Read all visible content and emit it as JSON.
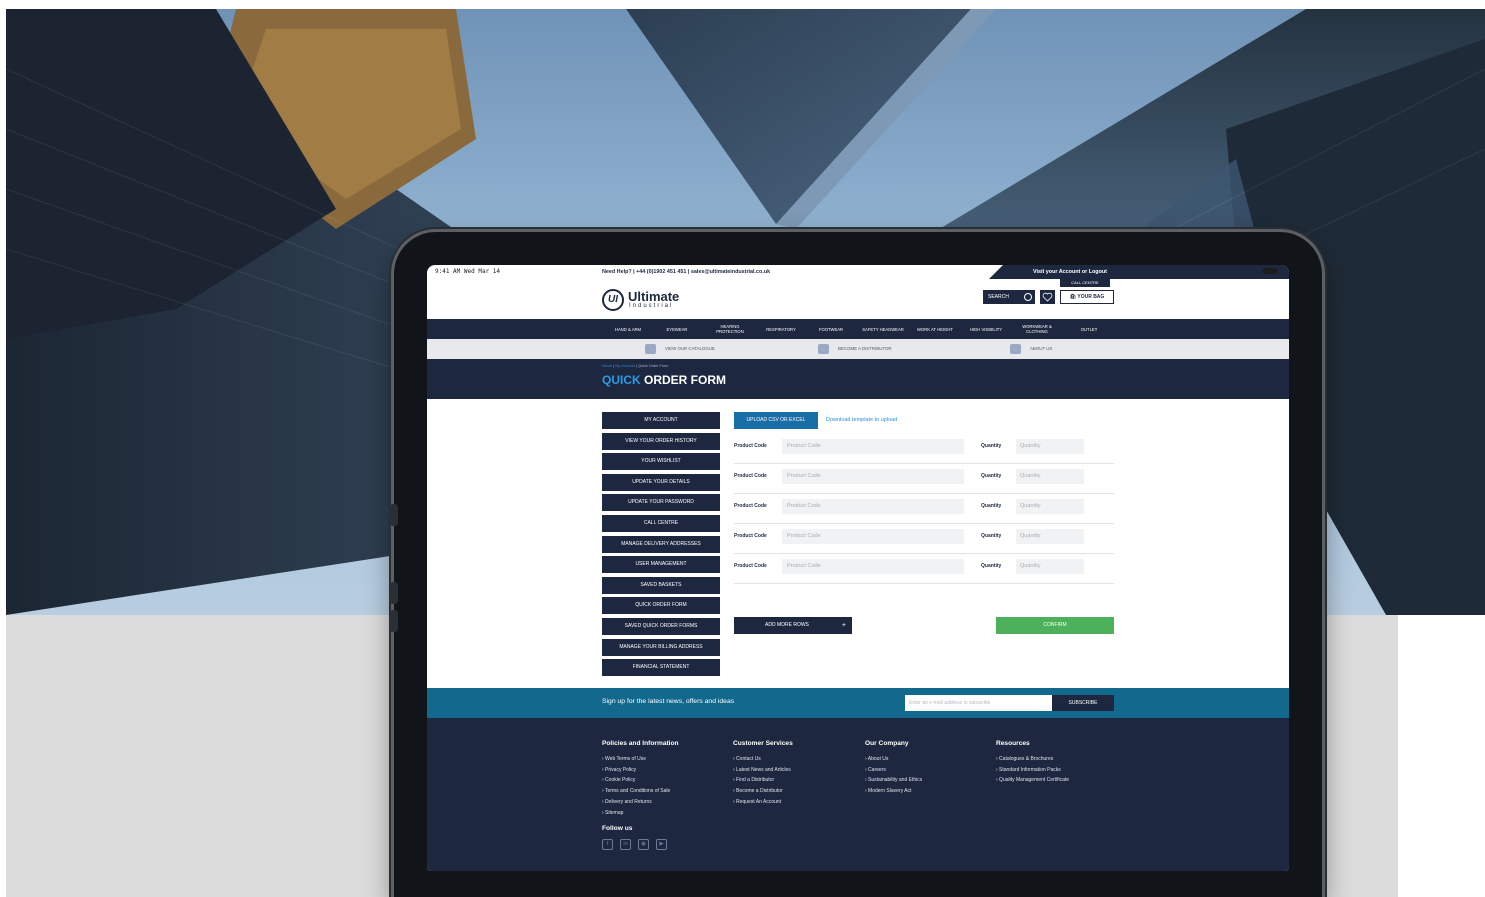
{
  "status_bar": {
    "time": "9:41 AM  Wed Mar 14"
  },
  "topbar": {
    "help": "Need Help?  |  +44 (0)1902 451 451  |  sales@ultimateindustrial.co.uk",
    "account": "Visit your Account or Logout",
    "call_centre": "CALL CENTRE"
  },
  "header": {
    "logo_mark": "UI",
    "logo_name": "Ultimate",
    "logo_sub": "Industrial",
    "search_label": "SEARCH",
    "bag_label": "YOUR BAG"
  },
  "nav": [
    "HAND & ARM",
    "EYEWEAR",
    "HEARING PROTECTION",
    "RESPIRATORY",
    "FOOTWEAR",
    "SAFETY HEADWEAR",
    "WORK AT HEIGHT",
    "HIGH VISIBILITY",
    "WORKWEAR & CLOTHING",
    "OUTLET"
  ],
  "utility": [
    "VIEW OUR CATALOGUE",
    "BECOME A DISTRIBUTOR",
    "ABOUT US"
  ],
  "breadcrumb": {
    "home": "Home",
    "account": "My Account",
    "current": "Quick Order Form"
  },
  "page_title": {
    "highlight": "QUICK",
    "rest": "ORDER FORM"
  },
  "side_menu": [
    "MY ACCOUNT",
    "VIEW YOUR ORDER HISTORY",
    "YOUR WISHLIST",
    "UPDATE YOUR DETAILS",
    "UPDATE YOUR PASSWORD",
    "CALL CENTRE",
    "MANAGE DELIVERY ADDRESSES",
    "USER MANAGEMENT",
    "SAVED BASKETS",
    "QUICK ORDER FORM",
    "SAVED QUICK ORDER FORMS",
    "MANAGE YOUR BILLING ADDRESS",
    "FINANCIAL STATEMENT"
  ],
  "form": {
    "upload_label": "UPLOAD CSV OR EXCEL",
    "download_link": "Download template to upload",
    "product_label": "Product Code",
    "product_placeholder": "Product Code",
    "qty_label": "Quantity",
    "qty_placeholder": "Quantity",
    "add_rows": "ADD MORE ROWS",
    "add_plus": "+",
    "confirm": "CONFIRM"
  },
  "newsletter": {
    "text": "Sign up for the latest news, offers and ideas",
    "placeholder": "Enter an e-mail address to subscribe",
    "button": "SUBSCRIBE"
  },
  "footer": {
    "columns": [
      {
        "title": "Policies and Information",
        "links": [
          "› Web Terms of Use",
          "› Privacy Policy",
          "› Cookie Policy",
          "› Terms and Conditions of Sale",
          "› Delivery and Returns",
          "› Sitemap"
        ]
      },
      {
        "title": "Customer Services",
        "links": [
          "› Contact Us",
          "› Latest News and Articles",
          "› Find a Distributor",
          "› Become a Distributor",
          "› Request An Account"
        ]
      },
      {
        "title": "Our Company",
        "links": [
          "› About Us",
          "› Careers",
          "› Sustainability and Ethics",
          "› Modern Slavery Act"
        ]
      },
      {
        "title": "Resources",
        "links": [
          "› Catalogues & Brochures",
          "› Standard Information Packs",
          "› Quality Management Certificate"
        ]
      }
    ],
    "follow": "Follow us",
    "social_icons": [
      "facebook-icon",
      "linkedin-icon",
      "instagram-icon",
      "youtube-icon"
    ]
  }
}
